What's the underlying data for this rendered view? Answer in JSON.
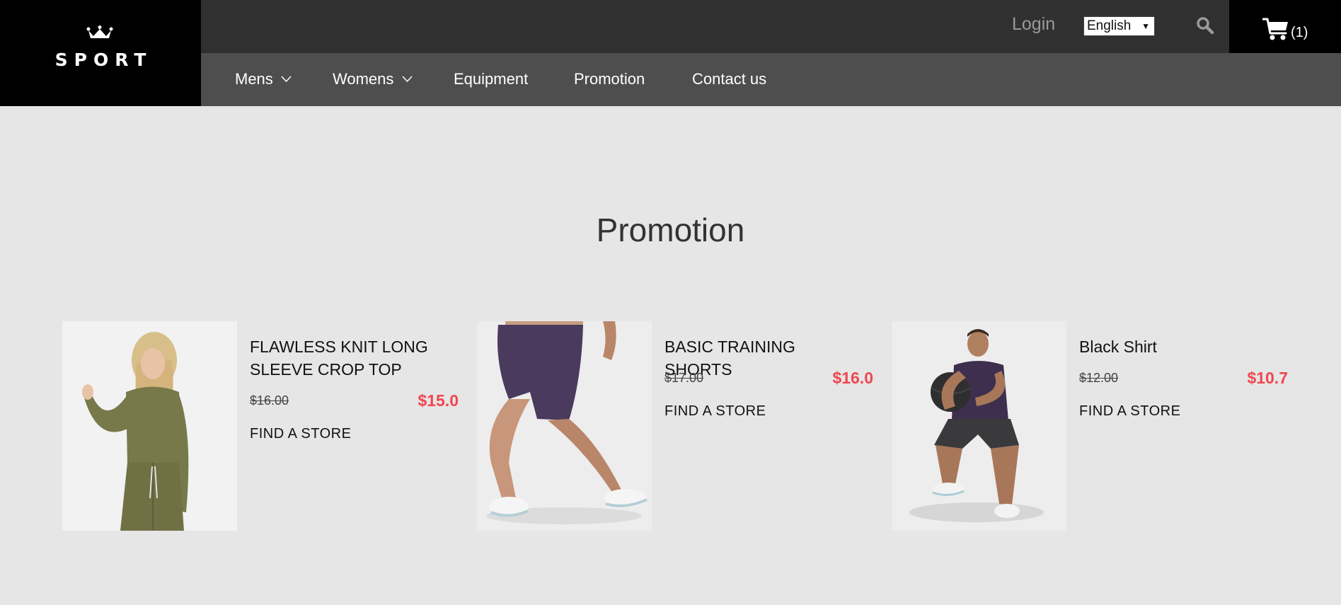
{
  "brand": {
    "name": "SPORT"
  },
  "header": {
    "login_label": "Login",
    "language_selected": "English",
    "cart_count": "(1)"
  },
  "nav": {
    "items": [
      {
        "label": "Mens",
        "has_dropdown": true
      },
      {
        "label": "Womens",
        "has_dropdown": true
      },
      {
        "label": "Equipment",
        "has_dropdown": false
      },
      {
        "label": "Promotion",
        "has_dropdown": false
      },
      {
        "label": "Contact us",
        "has_dropdown": false
      }
    ]
  },
  "main": {
    "title": "Promotion",
    "products": [
      {
        "name": "FLAWLESS KNIT LONG SLEEVE CROP TOP",
        "old_price": "$16.00",
        "new_price": "$15.0",
        "cta": "FIND A STORE"
      },
      {
        "name": "BASIC TRAINING SHORTS",
        "old_price": "$17.00",
        "new_price": "$16.0",
        "cta": "FIND A STORE"
      },
      {
        "name": "Black Shirt",
        "old_price": "$12.00",
        "new_price": "$10.7",
        "cta": "FIND A STORE"
      }
    ]
  },
  "colors": {
    "logo_bg": "#000000",
    "topbar_bg": "#303030",
    "navbar_bg": "#4e4e4e",
    "page_bg": "#e6e6e6",
    "sale_price": "#f04650"
  }
}
